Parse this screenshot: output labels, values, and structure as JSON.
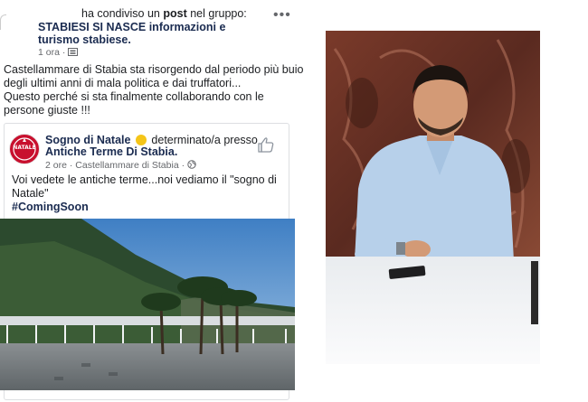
{
  "post": {
    "shared_prefix": "ha condiviso un",
    "shared_word": "post",
    "shared_suffix": "nel gruppo:",
    "group_name": "STABIESI SI NASCE informazioni e turismo stabiese.",
    "time": "1 ora",
    "dot": "·",
    "privacy_icon": "group-icon",
    "more_icon": "•••",
    "text_lines": [
      "Castellammare di Stabia sta risorgendo dal periodo più buio",
      "degli ultimi anni di mala politica e dai truffatori...",
      "Questo perché si sta finalmente collaborando con le",
      "persone giuste !!!"
    ]
  },
  "shared": {
    "avatar_label": "NATALE",
    "page_name": "Sogno di Natale",
    "feeling": "determinato/a presso",
    "location": "Antiche Terme Di Stabia.",
    "time": "2 ore",
    "dot": "·",
    "place": "Castellammare di Stabia",
    "dot2": "·",
    "text_lines": [
      "Voi vedete le antiche terme...noi vediamo il \"sogno di",
      "Natale\""
    ],
    "hashtag": "#ComingSoon"
  },
  "colors": {
    "link": "#1a2b50",
    "meta": "#65676b",
    "border": "#dddfe2",
    "badge": "#c8102e"
  }
}
